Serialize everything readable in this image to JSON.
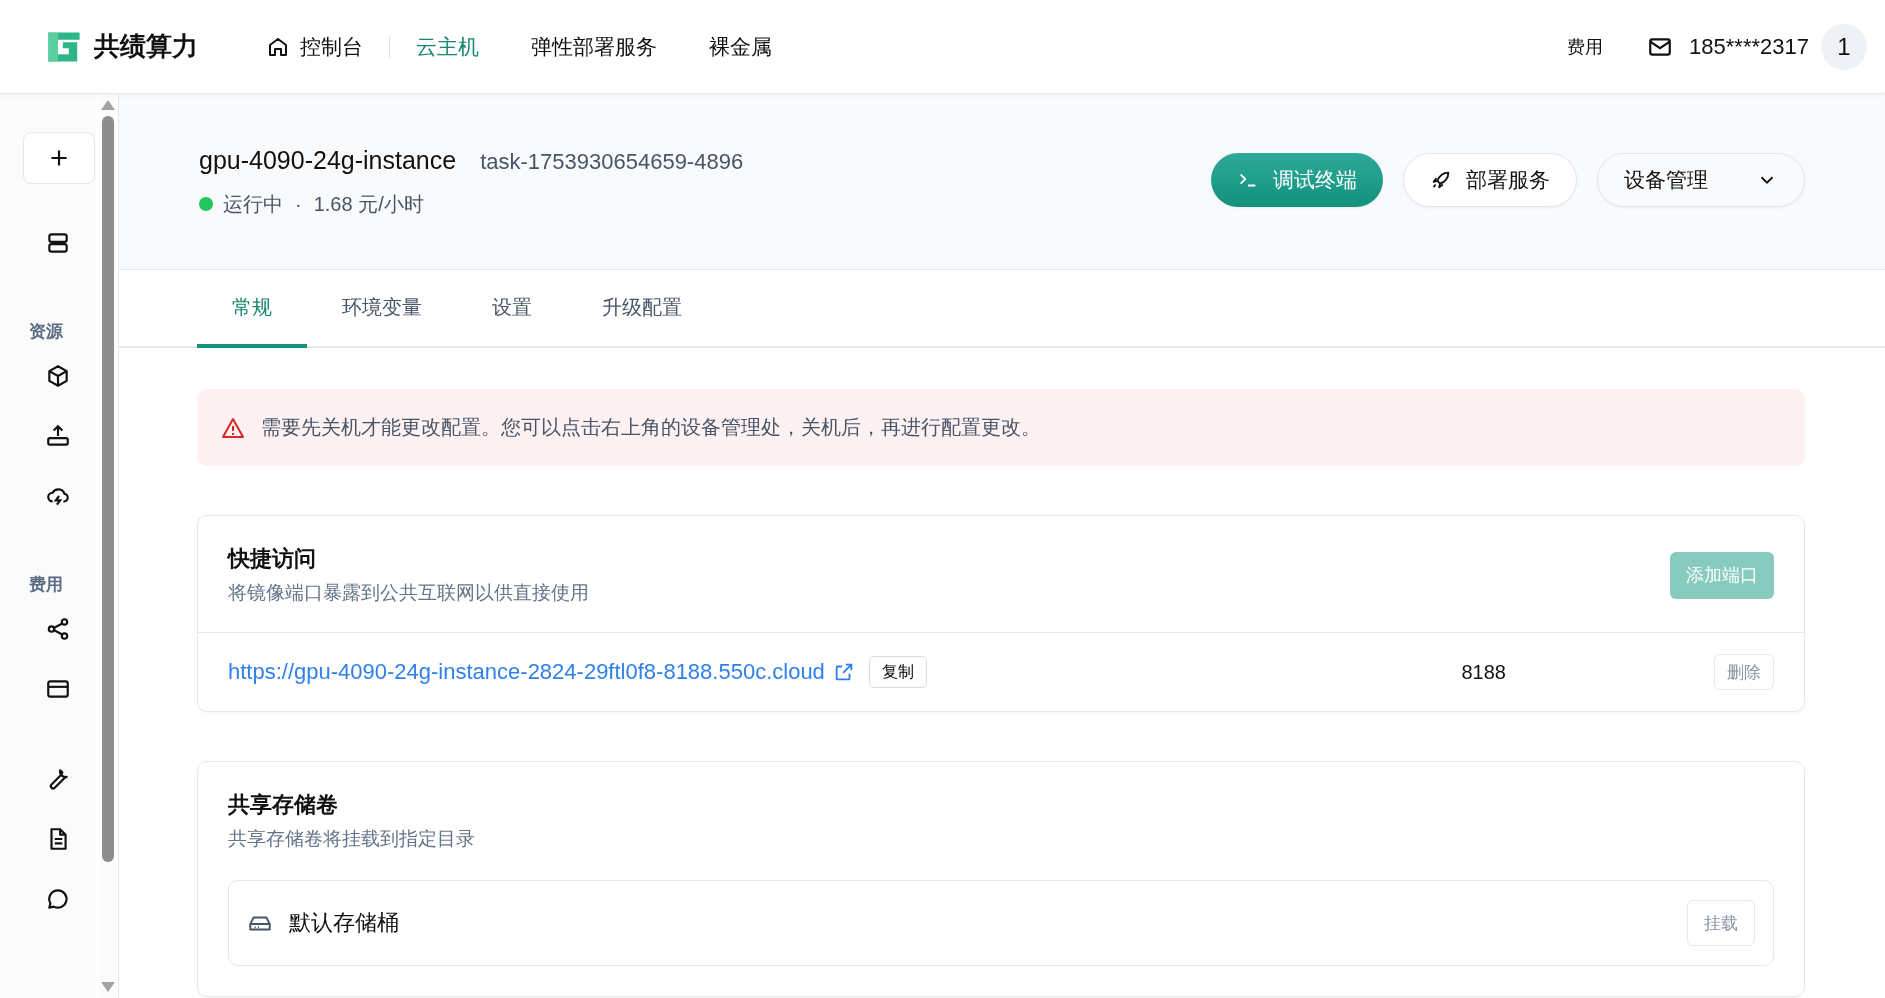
{
  "brand": {
    "name": "共绩算力"
  },
  "top_nav": [
    {
      "label": "控制台",
      "selected": false,
      "home": true
    },
    {
      "label": "云主机",
      "selected": true,
      "home": false
    },
    {
      "label": "弹性部署服务",
      "selected": false,
      "home": false
    },
    {
      "label": "裸金属",
      "selected": false,
      "home": false
    }
  ],
  "user_bar": {
    "billing": "费用",
    "phone": "185****2317",
    "avatar": "1"
  },
  "sidebar": {
    "sections": [
      "资源",
      "费用"
    ]
  },
  "instance": {
    "name": "gpu-4090-24g-instance",
    "task": "task-1753930654659-4896",
    "status": "运行中",
    "separator": "·",
    "price": "1.68 元/小时"
  },
  "actions": {
    "terminal": "调试终端",
    "deploy": "部署服务",
    "manage": "设备管理"
  },
  "tabs": [
    {
      "label": "常规",
      "selected": true
    },
    {
      "label": "环境变量",
      "selected": false
    },
    {
      "label": "设置",
      "selected": false
    },
    {
      "label": "升级配置",
      "selected": false
    }
  ],
  "alert": "需要先关机才能更改配置。您可以点击右上角的设备管理处，关机后，再进行配置更改。",
  "quick_access": {
    "title": "快捷访问",
    "subtitle": "将镜像端口暴露到公共互联网以供直接使用",
    "add_button": {
      "label": "添加端口",
      "disabled": true
    },
    "ports": [
      {
        "url": "https://gpu-4090-24g-instance-2824-29ftl0f8-8188.550c.cloud",
        "copy": "复制",
        "port": "8188",
        "delete": "删除"
      }
    ]
  },
  "storage": {
    "title": "共享存储卷",
    "subtitle": "共享存储卷将挂载到指定目录",
    "buckets": [
      {
        "name": "默认存储桶",
        "action": "挂载"
      }
    ]
  }
}
